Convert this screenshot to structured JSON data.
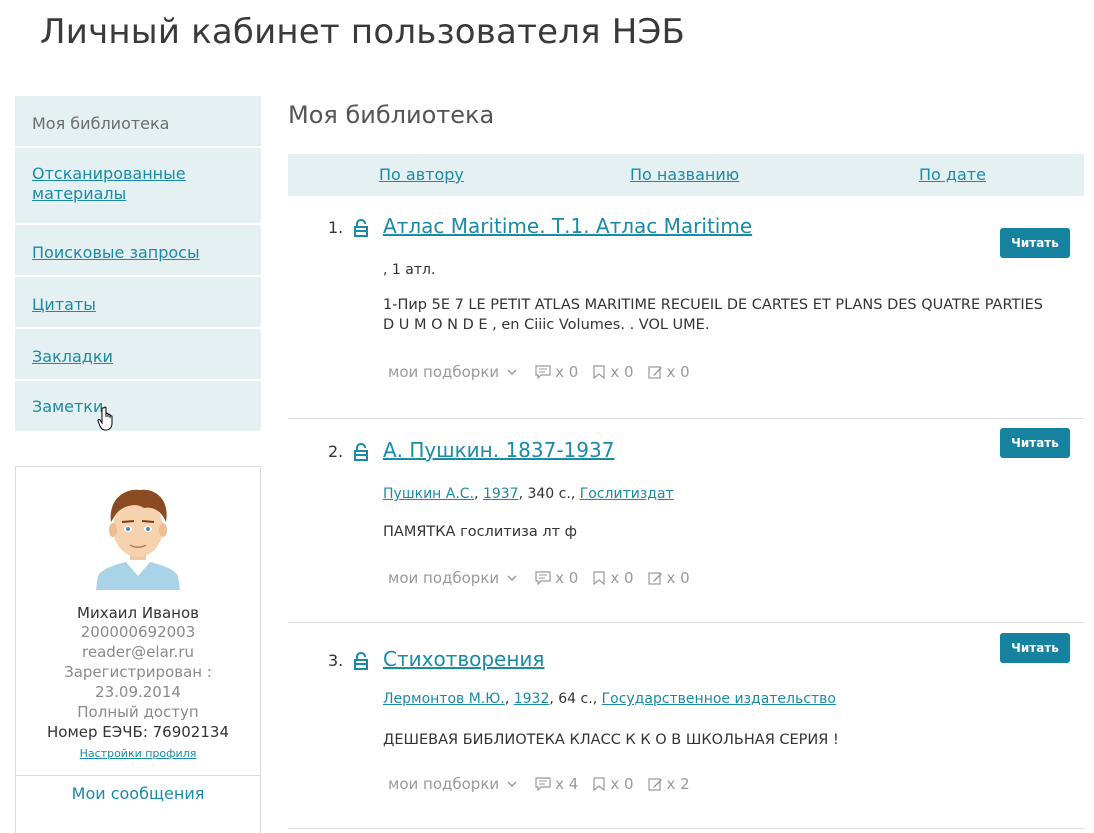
{
  "page_title": "Личный кабинет пользователя НЭБ",
  "sidebar": {
    "items": [
      {
        "label": "Моя библиотека"
      },
      {
        "label": "Отсканированные материалы"
      },
      {
        "label": "Поисковые запросы"
      },
      {
        "label": "Цитаты"
      },
      {
        "label": "Закладки"
      },
      {
        "label": "Заметки"
      }
    ]
  },
  "profile": {
    "name": "Михаил Иванов",
    "id": "200000692003",
    "email": "reader@elar.ru",
    "registered_label": "Зарегистрирован :",
    "registered_date": "23.09.2014",
    "access": "Полный доступ",
    "card": "Номер ЕЭЧБ: 76902134",
    "settings_link": "Настройки профиля",
    "messages_link": "Мои сообщения"
  },
  "main": {
    "title": "Моя библиотека",
    "sort": {
      "author": "По автору",
      "title": "По названию",
      "date": "По дате"
    },
    "read_label": "Читать",
    "collections_label": "мои подборки",
    "items": [
      {
        "num": "1.",
        "title": "Атлас Maritime. Т.1. Атлас Maritime",
        "meta_text": ", 1 атл.",
        "desc": "1-Пир 5Е 7 LE PETIT ATLAS MARITIME RECUEIL DE CARTES ET PLANS DES QUATRE PARTIES D U M O N D E , en Ciiic Volumes. . VOL UME.",
        "quotes": "x 0",
        "bookmarks": "x 0",
        "notes": "x 0"
      },
      {
        "num": "2.",
        "title": "А. Пушкин. 1837-1937",
        "author": "Пушкин А.С.",
        "year": "1937",
        "pages": ", 340 с., ",
        "publisher": "Гослитиздат",
        "desc": "ПАМЯТКА гослитиза лт ф",
        "quotes": "x 0",
        "bookmarks": "x 0",
        "notes": "x 0"
      },
      {
        "num": "3.",
        "title": "Стихотворения",
        "author": "Лермонтов М.Ю.",
        "year": "1932",
        "pages": ", 64 с., ",
        "publisher": "Государственное издательство",
        "desc": "ДЕШЕВАЯ БИБЛИОТЕКА КЛАСС К К О В ШКОЛЬНАЯ СЕРИЯ !",
        "quotes": "x 4",
        "bookmarks": "x 0",
        "notes": "x 2"
      }
    ]
  },
  "colors": {
    "accent": "#1a8ba6",
    "button": "#1583a0",
    "panel": "#e4f0f2"
  }
}
